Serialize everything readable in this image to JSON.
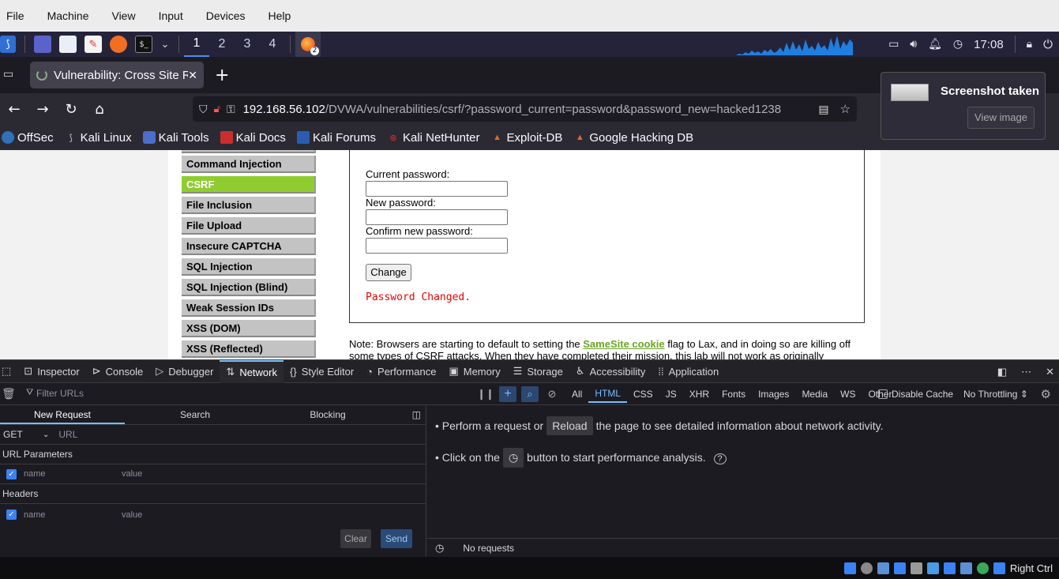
{
  "vbox_menu": {
    "items": [
      "File",
      "Machine",
      "View",
      "Input",
      "Devices",
      "Help"
    ]
  },
  "kali_panel": {
    "workspaces": [
      "1",
      "2",
      "3",
      "4"
    ],
    "active_workspace": "1",
    "firefox_badge": "2",
    "clock": "17:08"
  },
  "tab": {
    "title": "Vulnerability: Cross Site R",
    "new_tab_symbol": "+"
  },
  "url": {
    "host": "192.168.56.102",
    "path": "/DVWA/vulnerabilities/csrf/?password_current=password&password_new=hacked1238"
  },
  "bookmarks": [
    "OffSec",
    "Kali Linux",
    "Kali Tools",
    "Kali Docs",
    "Kali Forums",
    "Kali NetHunter",
    "Exploit-DB",
    "Google Hacking DB"
  ],
  "notification": {
    "title": "Screenshot taken",
    "button": "View image"
  },
  "dvwa_menu": {
    "items": [
      "Command Injection",
      "CSRF",
      "File Inclusion",
      "File Upload",
      "Insecure CAPTCHA",
      "SQL Injection",
      "SQL Injection (Blind)",
      "Weak Session IDs",
      "XSS (DOM)",
      "XSS (Reflected)"
    ],
    "active": "CSRF"
  },
  "csrf_form": {
    "current_label": "Current password:",
    "new_label": "New password:",
    "confirm_label": "Confirm new password:",
    "change_button": "Change",
    "message": "Password Changed."
  },
  "note": {
    "prefix": "Note: Browsers are starting to default to setting the ",
    "link": "SameSite cookie",
    "suffix": " flag to Lax, and in doing so are killing off some types of CSRF attacks. When they have completed their mission, this lab will not work as originally"
  },
  "devtools": {
    "tabs": [
      "Inspector",
      "Console",
      "Debugger",
      "Network",
      "Style Editor",
      "Performance",
      "Memory",
      "Storage",
      "Accessibility",
      "Application"
    ],
    "active_tab": "Network",
    "filter_placeholder": "Filter URLs",
    "types": [
      "All",
      "HTML",
      "CSS",
      "JS",
      "XHR",
      "Fonts",
      "Images",
      "Media",
      "WS",
      "Other"
    ],
    "active_type": "HTML",
    "disable_cache": "Disable Cache",
    "throttling": "No Throttling",
    "left_tabs": [
      "New Request",
      "Search",
      "Blocking"
    ],
    "method": "GET",
    "url_placeholder": "URL",
    "url_params_header": "URL Parameters",
    "headers_header": "Headers",
    "name_placeholder": "name",
    "value_placeholder": "value",
    "clear_button": "Clear",
    "send_button": "Send",
    "hint1_pre": "Perform a request or",
    "hint1_btn": "Reload",
    "hint1_post": "the page to see detailed information about network activity.",
    "hint2_pre": "Click on the",
    "hint2_post": "button to start performance analysis.",
    "status": "No requests"
  },
  "vbox_status": {
    "host_key": "Right Ctrl"
  }
}
